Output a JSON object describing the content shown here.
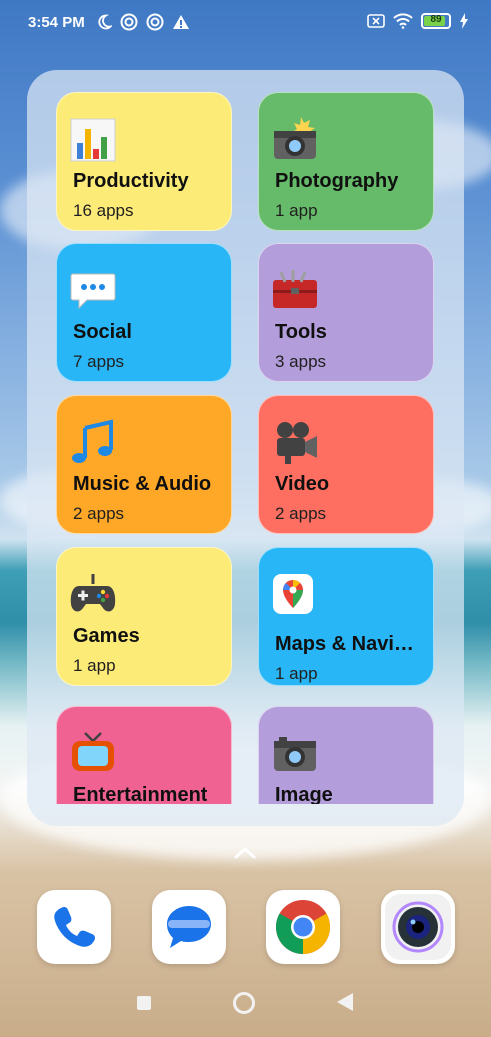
{
  "status_bar": {
    "time": "3:54 PM",
    "left_icons": [
      "moon-icon",
      "vpn-icon",
      "vpn-icon",
      "alert-icon"
    ],
    "right_icons": [
      "sim-x-icon",
      "wifi-icon",
      "battery-icon",
      "charging-icon"
    ],
    "battery_level": "89",
    "battery_fraction": 0.89
  },
  "folder": {
    "tiles": [
      {
        "name": "Productivity",
        "count": "16 apps",
        "color": "#fdeb78",
        "icon": "bar-chart-icon"
      },
      {
        "name": "Photography",
        "count": "1 app",
        "color": "#66bb6a",
        "icon": "camera-flash-icon"
      },
      {
        "name": "Social",
        "count": "7 apps",
        "color": "#29b6f6",
        "icon": "speech-bubble-icon"
      },
      {
        "name": "Tools",
        "count": "3 apps",
        "color": "#b39ddb",
        "icon": "toolbox-icon"
      },
      {
        "name": "Music & Audio",
        "count": "2 apps",
        "color": "#ffa726",
        "icon": "music-note-icon"
      },
      {
        "name": "Video",
        "count": "2 apps",
        "color": "#ff6f61",
        "icon": "movie-camera-icon"
      },
      {
        "name": "Games",
        "count": "1 app",
        "color": "#fdeb78",
        "icon": "gamepad-icon"
      },
      {
        "name": "Maps & Navi…",
        "count": "1 app",
        "color": "#29b6f6",
        "icon": "google-maps-icon"
      },
      {
        "name": "Entertainment",
        "count": "",
        "color": "#f06292",
        "icon": "tv-icon"
      },
      {
        "name": "Image",
        "count": "",
        "color": "#b39ddb",
        "icon": "camera-icon"
      }
    ]
  },
  "app_drawer_indicator": "chevron-up-icon",
  "dock": {
    "apps": [
      {
        "name": "Phone",
        "icon": "phone-icon"
      },
      {
        "name": "Messages",
        "icon": "messages-icon"
      },
      {
        "name": "Chrome",
        "icon": "chrome-icon"
      },
      {
        "name": "Camera",
        "icon": "camera-lens-icon"
      }
    ]
  },
  "nav_bar": {
    "buttons": [
      "recents-button",
      "home-button",
      "back-button"
    ]
  }
}
